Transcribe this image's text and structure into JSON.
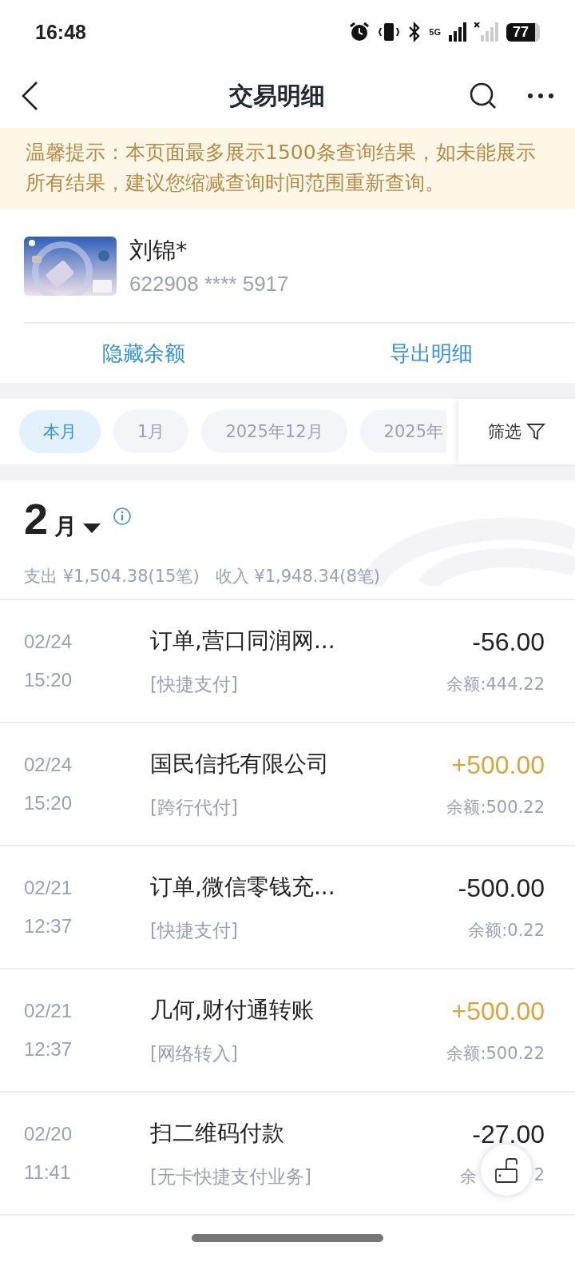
{
  "status_bar": {
    "time": "16:48",
    "network": "5G",
    "battery": "77"
  },
  "nav": {
    "title": "交易明细"
  },
  "notice": "温馨提示：本页面最多展示1500条查询结果，如未能展示所有结果，建议您缩减查询时间范围重新查询。",
  "account": {
    "name": "刘锦*",
    "number": "622908 **** 5917"
  },
  "actions": [
    "隐藏余额",
    "导出明细"
  ],
  "periods": [
    {
      "label": "本月",
      "selected": true
    },
    {
      "label": "1月",
      "selected": false
    },
    {
      "label": "2025年12月",
      "selected": false
    },
    {
      "label": "2025年",
      "selected": false
    }
  ],
  "filter": "筛选",
  "month": {
    "number": "2",
    "unit": "月",
    "summary": "支出 ¥1,504.38(15笔)   收入 ¥1,948.34(8笔)"
  },
  "transactions": [
    {
      "date": "02/24",
      "time": "15:20",
      "title": "订单,营口同润网...",
      "channel": "[快捷支付]",
      "amount": "-56.00",
      "balance": "余额:444.22",
      "kind": "expense"
    },
    {
      "date": "02/24",
      "time": "15:20",
      "title": "国民信托有限公司",
      "channel": "[跨行代付]",
      "amount": "+500.00",
      "balance": "余额:500.22",
      "kind": "income"
    },
    {
      "date": "02/21",
      "time": "12:37",
      "title": "订单,微信零钱充...",
      "channel": "[快捷支付]",
      "amount": "-500.00",
      "balance": "余额:0.22",
      "kind": "expense"
    },
    {
      "date": "02/21",
      "time": "12:37",
      "title": "几何,财付通转账",
      "channel": "[网络转入]",
      "amount": "+500.00",
      "balance": "余额:500.22",
      "kind": "income"
    },
    {
      "date": "02/20",
      "time": "11:41",
      "title": "扫二维码付款",
      "channel": "[无卡快捷支付业务]",
      "amount": "-27.00",
      "balance": "余",
      "balance_tail": "2",
      "kind": "expense"
    }
  ]
}
